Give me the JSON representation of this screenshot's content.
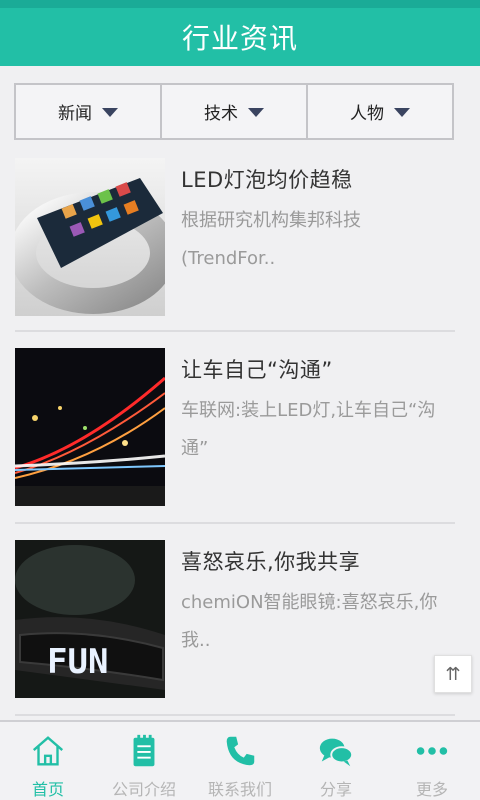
{
  "header": {
    "title": "行业资讯"
  },
  "filters": [
    {
      "label": "新闻"
    },
    {
      "label": "技术"
    },
    {
      "label": "人物"
    }
  ],
  "news": [
    {
      "title": "LED灯泡均价趋稳",
      "desc": "根据研究机构集邦科技(TrendFor.."
    },
    {
      "title": "让车自己“沟通”",
      "desc": "车联网:装上LED灯,让车自己“沟通”"
    },
    {
      "title": "喜怒哀乐,你我共享",
      "desc": "chemiON智能眼镜:喜怒哀乐,你我.."
    }
  ],
  "fun_text": "FUN",
  "scroll_top_label": "⇈",
  "tabs": [
    {
      "label": "首页",
      "icon": "home-icon"
    },
    {
      "label": "公司介绍",
      "icon": "notepad-icon"
    },
    {
      "label": "联系我们",
      "icon": "phone-icon"
    },
    {
      "label": "分享",
      "icon": "chat-icon"
    },
    {
      "label": "更多",
      "icon": "more-icon"
    }
  ],
  "colors": {
    "accent": "#22bfa6",
    "inactive": "#b5b5b5"
  }
}
